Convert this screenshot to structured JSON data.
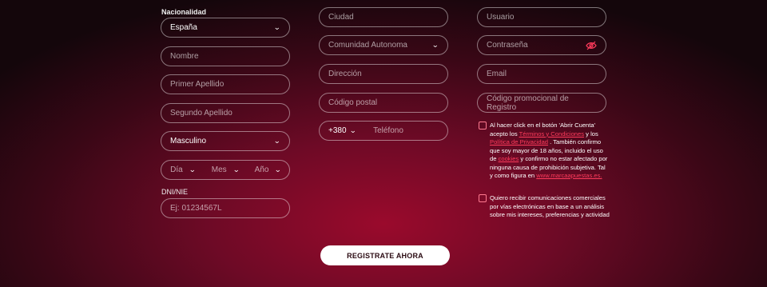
{
  "col1": {
    "nationality_label": "Nacionalidad",
    "nationality_value": "España",
    "name_placeholder": "Nombre",
    "surname1_placeholder": "Primer Apellido",
    "surname2_placeholder": "Segundo Apellido",
    "gender_value": "Masculino",
    "dob": {
      "day": "Día",
      "month": "Mes",
      "year": "Año"
    },
    "dni_label": "DNI/NIE",
    "dni_placeholder": "Ej: 01234567L"
  },
  "col2": {
    "city_placeholder": "Ciudad",
    "region_value": "Comunidad Autonoma",
    "address_placeholder": "Dirección",
    "postal_placeholder": "Código postal",
    "phone_prefix": "+380",
    "phone_placeholder": "Teléfono"
  },
  "col3": {
    "user_placeholder": "Usuario",
    "password_placeholder": "Contraseña",
    "email_placeholder": "Email",
    "promo_placeholder": "Código promocional de Registro",
    "terms": {
      "t1": "Al hacer click en el botón 'Abrir Cuenta' acepto los ",
      "l1": "Términos y Condiciones",
      "t2": " y los ",
      "l2": "Política de Privacidad",
      "t3": " . También confirmo que soy mayor de 18 años, incluido el uso de ",
      "l3": "cookies",
      "t4": " y confirmo no estar afectado por ninguna causa de prohibición subjetiva. Tal y como figura en ",
      "l4": "www.marcaapuestas.es."
    },
    "marketing": "Quiero recibir comunicaciones comerciales por vías electrónicas en base a un análisis sobre mis intereses, preferencias y actividad"
  },
  "submit_label": "REGISTRATE AHORA",
  "colors": {
    "accent": "#ff3b5c",
    "checkbox": "#ff7a90"
  }
}
